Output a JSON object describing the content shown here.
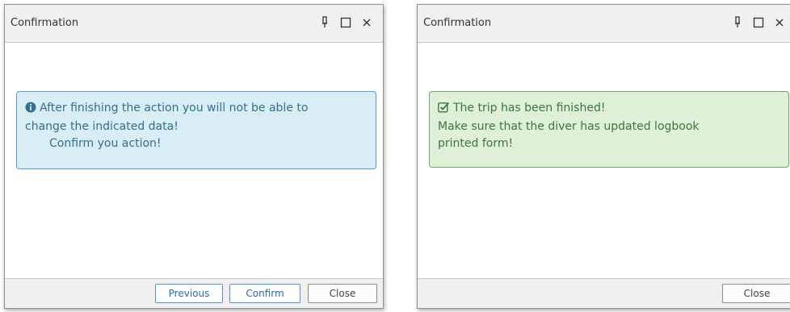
{
  "dialogs": [
    {
      "title": "Confirmation",
      "alert": {
        "type": "info",
        "icon": "info-circle-icon",
        "lines": [
          "After finishing the action you will not be able to",
          "change the indicated data!",
          "Confirm you action!"
        ]
      },
      "buttons": {
        "previous": "Previous",
        "confirm": "Confirm",
        "close": "Close"
      }
    },
    {
      "title": "Confirmation",
      "alert": {
        "type": "success",
        "icon": "check-square-icon",
        "lines": [
          "The trip has been finished!",
          "Make sure that the diver has updated logbook",
          "printed form!"
        ]
      },
      "buttons": {
        "close": "Close"
      }
    }
  ],
  "window_controls": [
    "pin-icon",
    "maximize-icon",
    "close-icon"
  ],
  "colors": {
    "info_bg": "#d9edf7",
    "info_border": "#5b9bd5",
    "info_text": "#31708f",
    "success_bg": "#dff0d8",
    "success_border": "#6aad5f",
    "success_text": "#3c763d",
    "button_accent": "#4a90d9"
  }
}
